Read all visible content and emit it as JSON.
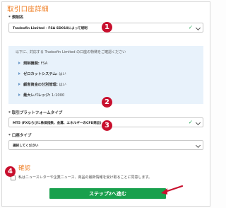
{
  "section_title": "取引口座詳細",
  "regulator": {
    "label": "規制名",
    "value": "Tradexfin Limited - FSA SD010によって規制"
  },
  "info": {
    "intro": "以下に、対応する Tradexfin Limited の口座の特徴をご確認ください",
    "items": [
      {
        "key": "規制機関:",
        "value": "FSA"
      },
      {
        "key": "ゼロカットシステム:",
        "value": "はい"
      },
      {
        "key": "顧客資金の分別管理:",
        "value": "はい"
      },
      {
        "key": "最大レバレッジ:",
        "value": "1:1000"
      }
    ]
  },
  "platform": {
    "label": "取引プラットフォームタイプ",
    "value": "MT5 (FXならびに株価指数、金属、エネルギーのCFD商品)"
  },
  "account_type": {
    "label": "口座タイプ",
    "value": "選択してください"
  },
  "confirm": {
    "title": "確認",
    "consent": "私はニュースレターや企業ニュース、商品の最新情報を受け取ることに同意します。",
    "next_button": "ステップ2へ進む"
  },
  "markers": [
    "1",
    "2",
    "3",
    "4"
  ],
  "required_mark": "*",
  "colors": {
    "accent_orange": "#ef7d22",
    "marker_red": "#c8102e",
    "button_green": "#19a04d",
    "check_green": "#22a654",
    "info_bg": "#e8f2fb"
  },
  "icons": [
    "check-icon",
    "chevron-down-icon",
    "bullet-icon",
    "arrow-icon"
  ]
}
